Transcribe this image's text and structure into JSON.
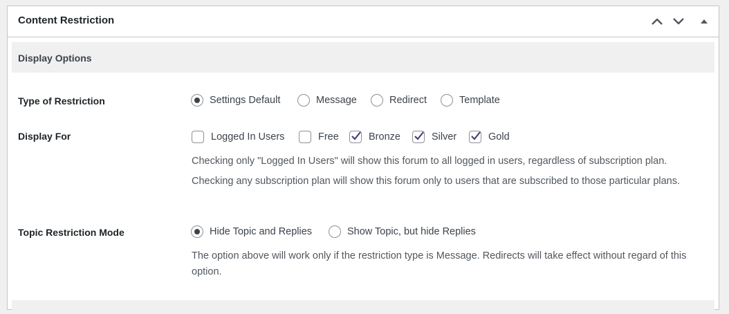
{
  "panel": {
    "title": "Content Restriction",
    "controls": [
      "move-up-icon",
      "move-down-icon",
      "toggle-panel-icon"
    ]
  },
  "section": {
    "title": "Display Options"
  },
  "restriction_type": {
    "label": "Type of Restriction",
    "options": [
      {
        "label": "Settings Default",
        "checked": true
      },
      {
        "label": "Message",
        "checked": false
      },
      {
        "label": "Redirect",
        "checked": false
      },
      {
        "label": "Template",
        "checked": false
      }
    ]
  },
  "display_for": {
    "label": "Display For",
    "options": [
      {
        "label": "Logged In Users",
        "checked": false
      },
      {
        "label": "Free",
        "checked": false
      },
      {
        "label": "Bronze",
        "checked": true
      },
      {
        "label": "Silver",
        "checked": true
      },
      {
        "label": "Gold",
        "checked": true
      }
    ],
    "help_1": "Checking only \"Logged In Users\" will show this forum to all logged in users, regardless of subscription plan.",
    "help_2": "Checking any subscription plan will show this forum only to users that are subscribed to those particular plans."
  },
  "topic_mode": {
    "label": "Topic Restriction Mode",
    "options": [
      {
        "label": "Hide Topic and Replies",
        "checked": true
      },
      {
        "label": "Show Topic, but hide Replies",
        "checked": false
      }
    ],
    "help": "The option above will work only if the restriction type is Message. Redirects will take effect without regard of this option."
  },
  "colors": {
    "accent": "#4f3b78",
    "border": "#c3c4c7",
    "section_bg": "#f0f0f1"
  }
}
